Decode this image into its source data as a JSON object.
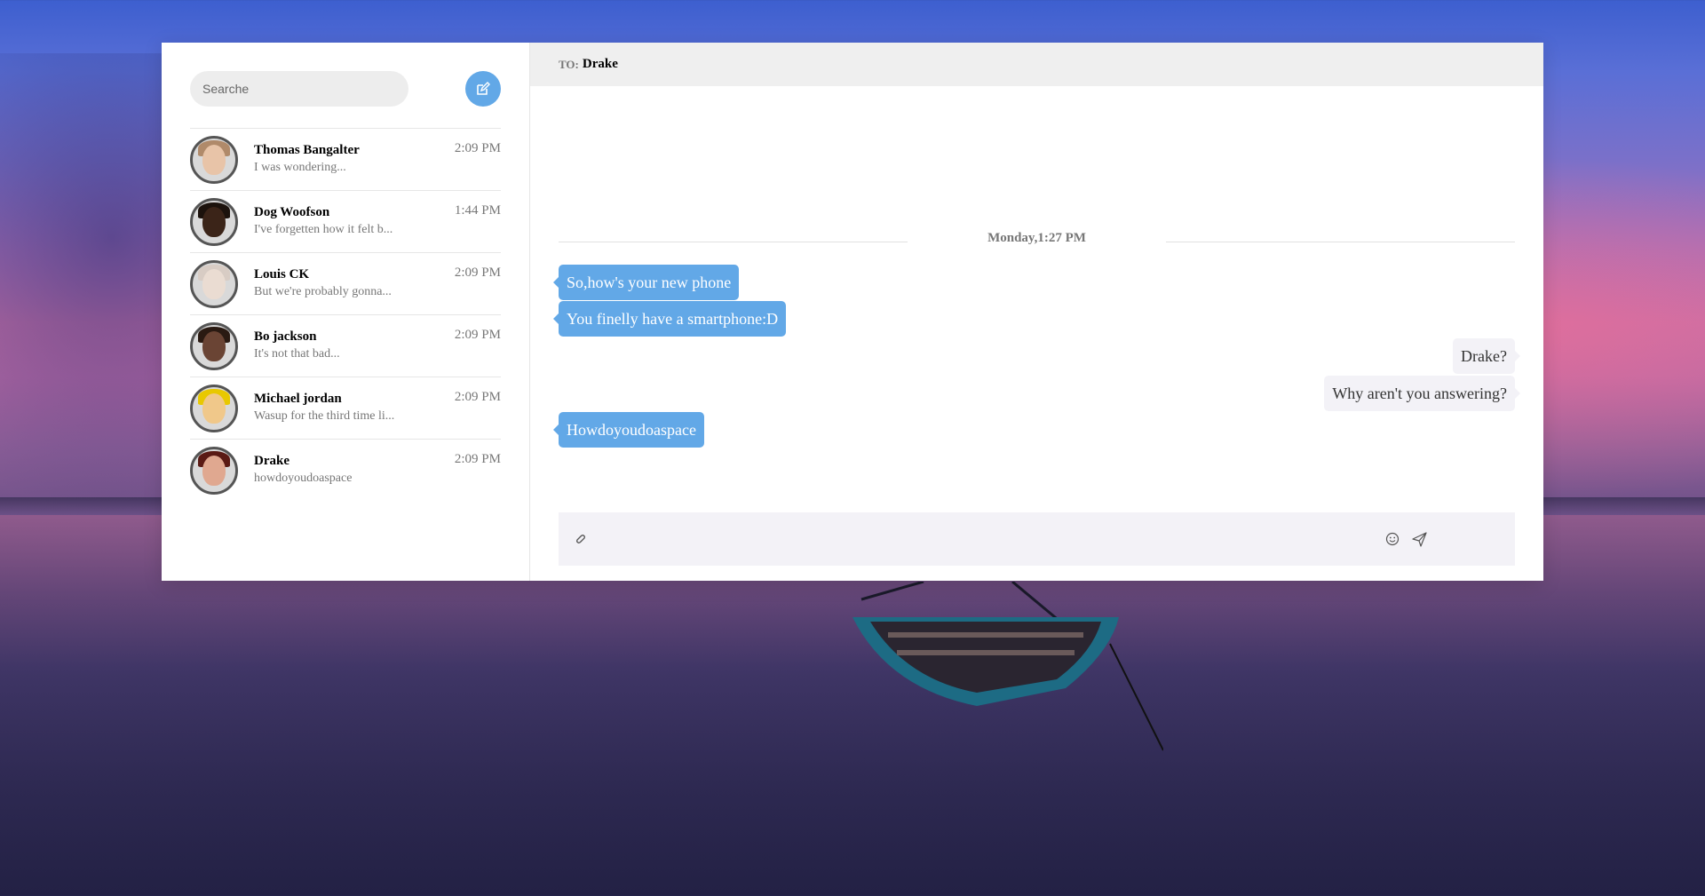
{
  "sidebar": {
    "search_placeholder": "Searche",
    "contacts": [
      {
        "name": "Thomas Bangalter",
        "preview": "I was wondering...",
        "time": "2:09 PM",
        "skin": "#e8c4a8",
        "hair": "#b08a6a"
      },
      {
        "name": "Dog Woofson",
        "preview": "I've forgetten how it felt b...",
        "time": "1:44 PM",
        "skin": "#3b2418",
        "hair": "#1c120c"
      },
      {
        "name": "Louis CK",
        "preview": "But we're probably gonna...",
        "time": "2:09 PM",
        "skin": "#eadcd2",
        "hair": "#d8ccc4"
      },
      {
        "name": "Bo jackson",
        "preview": "It's not that bad...",
        "time": "2:09 PM",
        "skin": "#6a4434",
        "hair": "#2a1a12"
      },
      {
        "name": "Michael jordan",
        "preview": "Wasup for the third time li...",
        "time": "2:09 PM",
        "skin": "#f0c88a",
        "hair": "#e8c800"
      },
      {
        "name": "Drake",
        "preview": "howdoyoudoaspace",
        "time": "2:09 PM",
        "skin": "#e0a890",
        "hair": "#5a1a14"
      }
    ]
  },
  "chat": {
    "to_label": "TO:",
    "to_name": "Drake",
    "date_separator": "Monday,1:27 PM",
    "messages": [
      {
        "direction": "in",
        "text": "So,how's your new phone"
      },
      {
        "direction": "in",
        "text": "You finelly have a smartphone:D"
      },
      {
        "direction": "out",
        "text": "Drake?"
      },
      {
        "direction": "out",
        "text": "Why aren't you answering?"
      },
      {
        "direction": "in",
        "text": "Howdoyoudoaspace"
      }
    ],
    "composer_placeholder": ""
  },
  "colors": {
    "accent": "#62a8e7",
    "outgoing_bubble": "#f3f2f7",
    "header_bg": "#efefef"
  },
  "icons": {
    "compose": "pencil-square-icon",
    "attach": "paperclip-icon",
    "emoji": "smiley-icon",
    "send": "paper-plane-icon"
  }
}
